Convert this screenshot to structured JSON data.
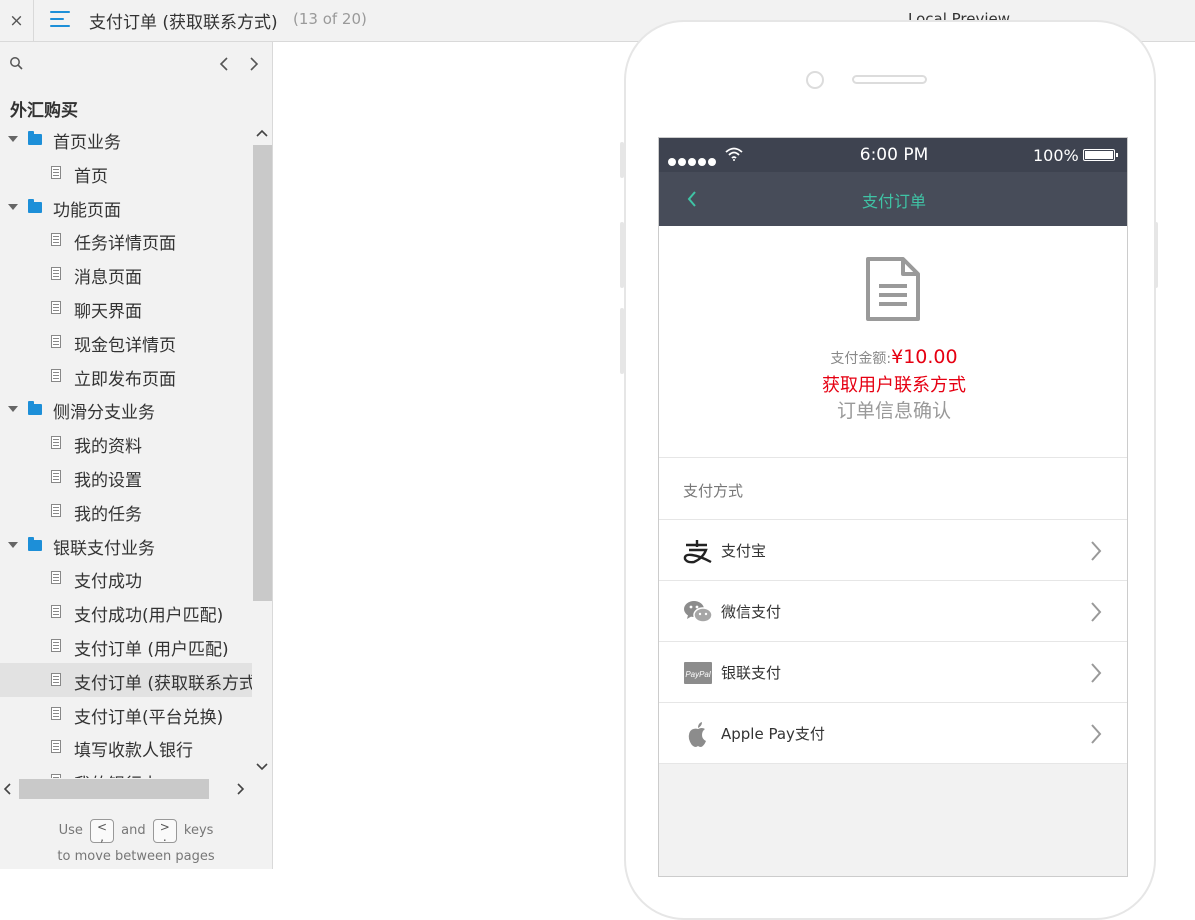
{
  "topbar": {
    "close_label": "×",
    "page_title": "支付订单 (获取联系方式)",
    "page_counter": "(13 of 20)",
    "preview_label": "Local Preview"
  },
  "sidebar": {
    "project_title": "外汇购买",
    "tree": [
      {
        "type": "folder",
        "label": "首页业务"
      },
      {
        "type": "page",
        "label": "首页"
      },
      {
        "type": "folder",
        "label": "功能页面"
      },
      {
        "type": "page",
        "label": "任务详情页面"
      },
      {
        "type": "page",
        "label": "消息页面"
      },
      {
        "type": "page",
        "label": "聊天界面"
      },
      {
        "type": "page",
        "label": "现金包详情页"
      },
      {
        "type": "page",
        "label": "立即发布页面"
      },
      {
        "type": "folder",
        "label": "侧滑分支业务"
      },
      {
        "type": "page",
        "label": "我的资料"
      },
      {
        "type": "page",
        "label": "我的设置"
      },
      {
        "type": "page",
        "label": "我的任务"
      },
      {
        "type": "folder",
        "label": "银联支付业务"
      },
      {
        "type": "page",
        "label": "支付成功"
      },
      {
        "type": "page",
        "label": "支付成功(用户匹配)"
      },
      {
        "type": "page",
        "label": "支付订单 (用户匹配)"
      },
      {
        "type": "page",
        "label": "支付订单 (获取联系方式)",
        "selected": true
      },
      {
        "type": "page",
        "label": "支付订单(平台兑换)"
      },
      {
        "type": "page",
        "label": "填写收款人银行"
      },
      {
        "type": "page",
        "label": "我的银行卡"
      }
    ],
    "hint": {
      "use": "Use",
      "prev_key": "<",
      "prev_key_sub": ",",
      "and": "and",
      "next_key": ">",
      "next_key_sub": ".",
      "keys": "keys",
      "line2": "to move between pages"
    }
  },
  "phone": {
    "status": {
      "time": "6:00 PM",
      "battery": "100%"
    },
    "nav_title": "支付订单",
    "amount_label": "支付金额:",
    "amount_value": "¥10.00",
    "contact_text": "获取用户联系方式",
    "confirm_text": "订单信息确认",
    "payment_header": "支付方式",
    "payment_methods": [
      {
        "label": "支付宝",
        "icon": "alipay-icon"
      },
      {
        "label": "微信支付",
        "icon": "wechat-icon"
      },
      {
        "label": "银联支付",
        "icon": "paypal-icon"
      },
      {
        "label": "Apple Pay支付",
        "icon": "apple-icon"
      }
    ],
    "paypal_badge": "PayPal"
  },
  "colors": {
    "accent_blue": "#1d8fd8",
    "nav_teal": "#3fc3a5",
    "price_red": "#e60012",
    "status_bar": "#3e4350",
    "nav_bar": "#474c59"
  }
}
